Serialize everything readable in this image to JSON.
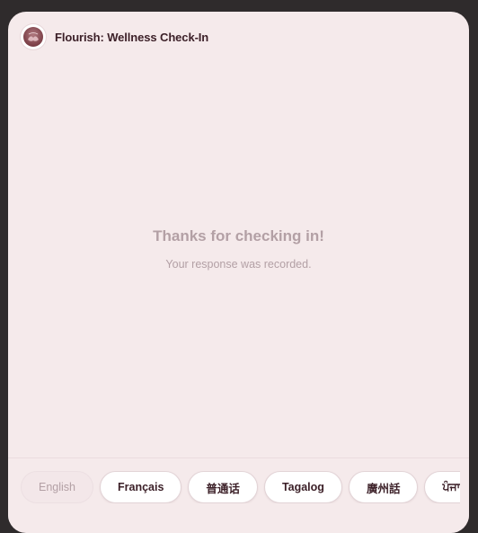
{
  "app": {
    "title": "Flourish: Wellness Check-In",
    "logo_icon": "flourish-logo-icon"
  },
  "message": {
    "heading": "Thanks for checking in!",
    "subtext": "Your response was recorded."
  },
  "languages": {
    "selected": "English",
    "items": [
      {
        "label": "English"
      },
      {
        "label": "Français"
      },
      {
        "label": "普通话"
      },
      {
        "label": "Tagalog"
      },
      {
        "label": "廣州話"
      },
      {
        "label": "ਪੰਜਾਬੀ"
      }
    ]
  },
  "colors": {
    "panel_bg": "#f5eaeb",
    "outer_bg": "#2f2b2c",
    "title_text": "#3b1f27",
    "muted_text": "#b3a0a5"
  }
}
